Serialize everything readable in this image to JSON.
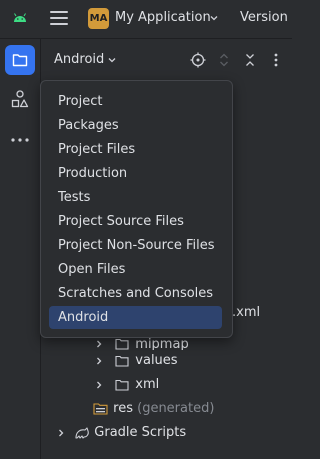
{
  "titlebar": {
    "project_badge": "MA",
    "app_name": "My Application",
    "version_label": "Version"
  },
  "panel": {
    "view_title": "Android"
  },
  "view_menu": {
    "items": [
      {
        "label": "Project"
      },
      {
        "label": "Packages"
      },
      {
        "label": "Project Files"
      },
      {
        "label": "Production"
      },
      {
        "label": "Tests"
      },
      {
        "label": "Project Source Files"
      },
      {
        "label": "Project Non-Source Files"
      },
      {
        "label": "Open Files"
      },
      {
        "label": "Scratches and Consoles"
      },
      {
        "label": "Android",
        "selected": true
      }
    ]
  },
  "tree": {
    "partial_xml_suffix": ".xml",
    "mipmap_label": "mipmap",
    "values_label": "values",
    "xml_label": "xml",
    "res_label": "res",
    "res_note": "(generated)",
    "gradle_label": "Gradle Scripts"
  },
  "colors": {
    "accent": "#3574f0",
    "selection": "#2e436e",
    "badge": "#d29a3a",
    "android_green": "#3ddc84"
  }
}
